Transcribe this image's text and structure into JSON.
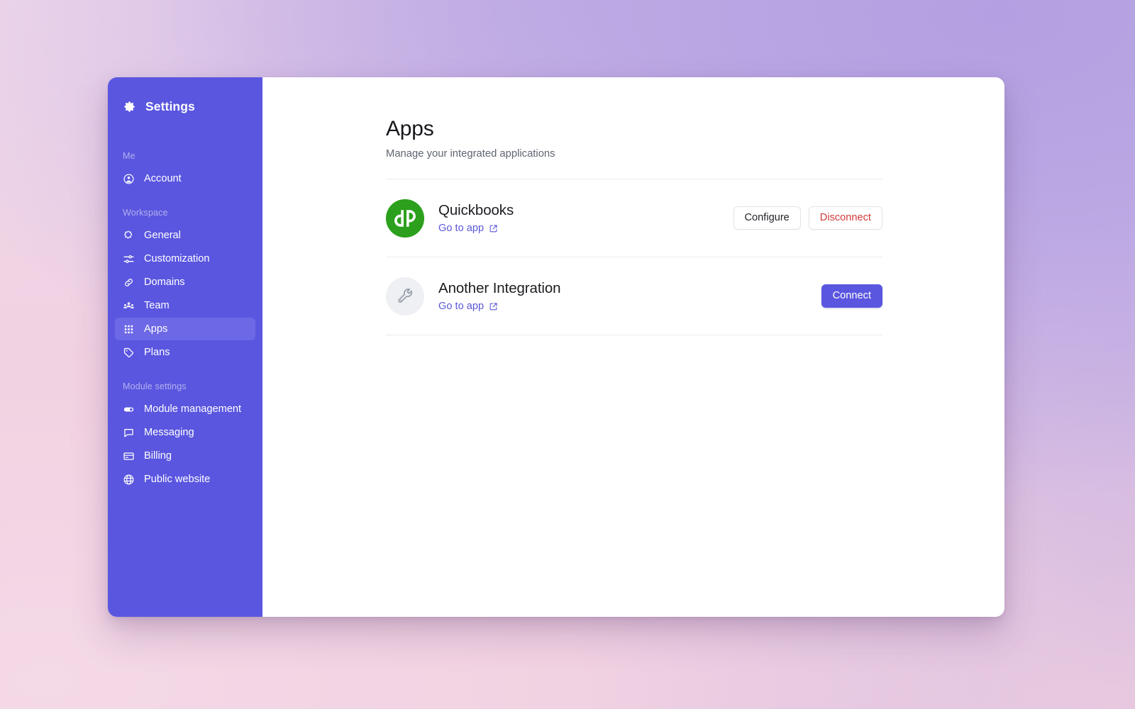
{
  "sidebar": {
    "brand": {
      "label": "Settings",
      "icon": "gear-icon"
    },
    "sections": [
      {
        "label": "Me",
        "items": [
          {
            "label": "Account",
            "icon": "user-circle-icon",
            "active": false
          }
        ]
      },
      {
        "label": "Workspace",
        "items": [
          {
            "label": "General",
            "icon": "puzzle-icon",
            "active": false
          },
          {
            "label": "Customization",
            "icon": "sliders-icon",
            "active": false
          },
          {
            "label": "Domains",
            "icon": "link-icon",
            "active": false
          },
          {
            "label": "Team",
            "icon": "people-icon",
            "active": false
          },
          {
            "label": "Apps",
            "icon": "grid-icon",
            "active": true
          },
          {
            "label": "Plans",
            "icon": "tag-icon",
            "active": false
          }
        ]
      },
      {
        "label": "Module settings",
        "items": [
          {
            "label": "Module management",
            "icon": "toggle-icon",
            "active": false
          },
          {
            "label": "Messaging",
            "icon": "chat-bubble-icon",
            "active": false
          },
          {
            "label": "Billing",
            "icon": "credit-card-icon",
            "active": false
          },
          {
            "label": "Public website",
            "icon": "globe-icon",
            "active": false
          }
        ]
      }
    ]
  },
  "page": {
    "title": "Apps",
    "subtitle": "Manage your integrated applications"
  },
  "apps": [
    {
      "name": "Quickbooks",
      "link_label": "Go to app",
      "link_icon": "external-link-icon",
      "logo": "quickbooks-logo",
      "logo_color": "#2ca01c",
      "actions": [
        {
          "label": "Configure",
          "style": "secondary"
        },
        {
          "label": "Disconnect",
          "style": "danger"
        }
      ]
    },
    {
      "name": "Another Integration",
      "link_label": "Go to app",
      "link_icon": "external-link-icon",
      "logo": "wrench-icon",
      "logo_color": "#eef0f3",
      "actions": [
        {
          "label": "Connect",
          "style": "primary"
        }
      ]
    }
  ],
  "theme": {
    "sidebar_bg": "#5a56e0",
    "accent": "#5a56e0",
    "danger": "#d13b3b",
    "link": "#5b57d8"
  }
}
